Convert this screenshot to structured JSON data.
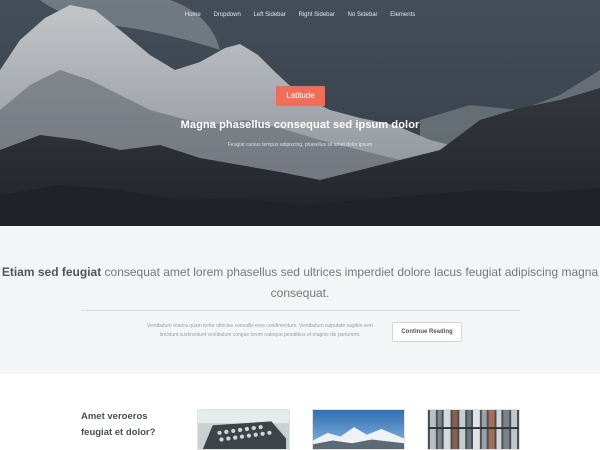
{
  "nav": {
    "items": [
      "Home",
      "Dropdown",
      "Left Sidebar",
      "Right Sidebar",
      "No Sidebar",
      "Elements"
    ]
  },
  "hero": {
    "badge": "Latitude",
    "title": "Magna phasellus consequat sed ipsum dolor",
    "subtitle": "Feugiat cursus tempus adipiscing, phasellus sit amet dolor ipsum"
  },
  "intro": {
    "heading_bold": "Etiam sed feugiat",
    "heading_rest": " consequat amet lorem phasellus sed ultrices imperdiet dolore lacus feugiat adipiscing magna consequat.",
    "body": "Vestibulum viverra quam tortor ultricies convallis eros condimentum. Vestibulum vulputate sagittis sem tincidunt sustincidunt vestibulum congue lorem natoque penatibus et magnis dis parturient.",
    "button": "Continue Reading"
  },
  "bottom": {
    "title": "Amet veroeros feugiat et dolor?",
    "thumbs": [
      "typewriter-image",
      "mountain-image",
      "bookshelf-image"
    ]
  },
  "colors": {
    "accent": "#ef6e5b",
    "intro_bg": "#f4f5f6"
  }
}
